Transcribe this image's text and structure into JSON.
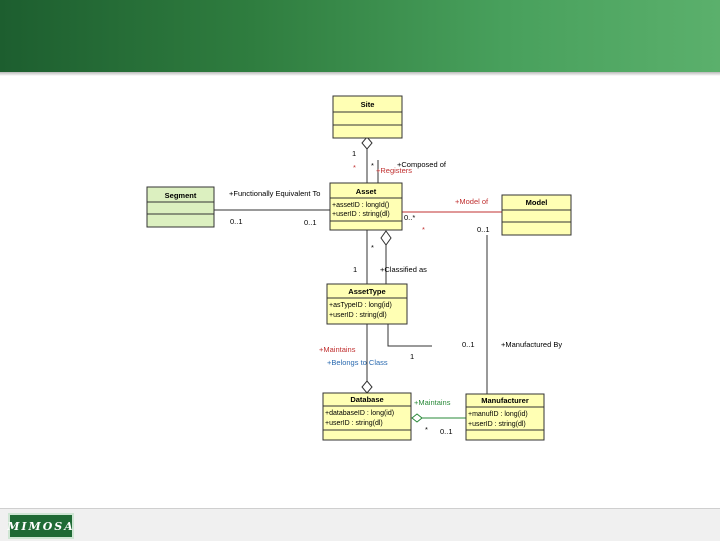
{
  "logo": "MIMOSA",
  "classes": {
    "site": {
      "name": "Site"
    },
    "segment": {
      "name": "Segment"
    },
    "asset": {
      "name": "Asset",
      "attributes": [
        "+assetID : longId()",
        "+userID : string(dl)"
      ]
    },
    "model": {
      "name": "Model"
    },
    "asset_type": {
      "name": "AssetType",
      "attributes": [
        "+asTypeID : long(id)",
        "+userID : string(dl)"
      ]
    },
    "database": {
      "name": "Database",
      "attributes": [
        "+databaseID : long(id)",
        "+userID : string(dl)"
      ]
    },
    "manufacturer": {
      "name": "Manufacturer",
      "attributes": [
        "+manufID : long(id)",
        "+userID : string(dl)"
      ]
    }
  },
  "labels": {
    "site_mult": "1",
    "registers": "+Registers",
    "composed_of": "+Composed of",
    "star_a": "*",
    "star_b": "*",
    "func_equiv": "+Functionally Equivalent To",
    "zero_one_seg": "0..1",
    "zero_one_asset": "0..1",
    "model_of": "+Model of",
    "zero_star_model": "0..*",
    "star_model": "*",
    "zero_one_model": "0..1",
    "classified_as": "+Classified as",
    "one_classified": "1",
    "star_classified": "*",
    "maintains_red": "+Maintains",
    "belongs_to_class": "+Belongs to Class",
    "one_at": "1",
    "zero_one_mfr": "0..1",
    "manufactured_by": "+Manufactured By",
    "maintains_green": "+Maintains",
    "star_db": "*",
    "zero_one_db": "0..1"
  }
}
